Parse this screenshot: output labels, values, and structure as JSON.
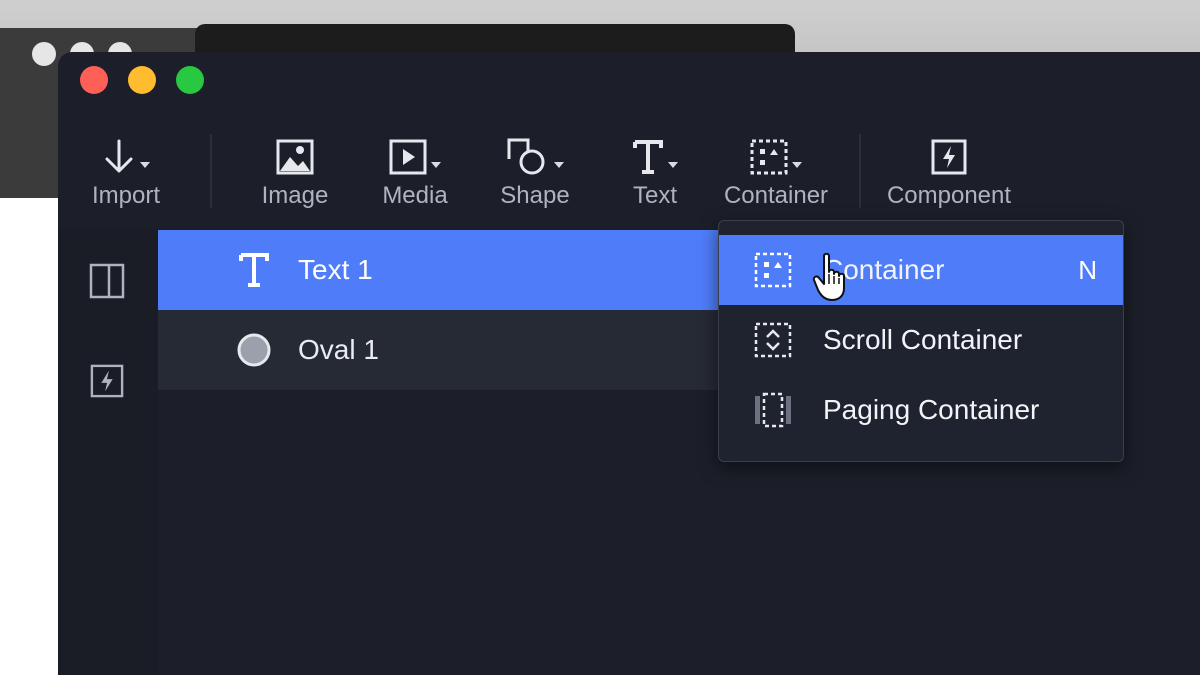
{
  "toolbar": {
    "items": [
      {
        "label": "Import",
        "icon": "arrow-down-icon",
        "has_caret": true
      },
      {
        "label": "Image",
        "icon": "image-icon",
        "has_caret": false
      },
      {
        "label": "Media",
        "icon": "media-play-icon",
        "has_caret": true
      },
      {
        "label": "Shape",
        "icon": "shape-icon",
        "has_caret": true
      },
      {
        "label": "Text",
        "icon": "text-icon",
        "has_caret": true
      },
      {
        "label": "Container",
        "icon": "container-icon",
        "has_caret": true
      },
      {
        "label": "Component",
        "icon": "component-icon",
        "has_caret": false
      }
    ]
  },
  "sidebar": {
    "icons": [
      "panel-icon",
      "component-icon"
    ]
  },
  "layers": {
    "rows": [
      {
        "label": "Text 1",
        "icon": "text-icon",
        "selected": true
      },
      {
        "label": "Oval 1",
        "icon": "oval-icon",
        "selected": false
      }
    ]
  },
  "container_menu": {
    "items": [
      {
        "label": "Container",
        "shortcut": "N",
        "icon": "container-icon",
        "active": true
      },
      {
        "label": "Scroll Container",
        "shortcut": "",
        "icon": "scroll-container-icon",
        "active": false
      },
      {
        "label": "Paging Container",
        "shortcut": "",
        "icon": "paging-container-icon",
        "active": false
      }
    ]
  },
  "colors": {
    "accent": "#4f7df9",
    "window_bg": "#1c1f29",
    "traffic_red": "#fe5f57",
    "traffic_yellow": "#febc2e",
    "traffic_green": "#28c840"
  }
}
